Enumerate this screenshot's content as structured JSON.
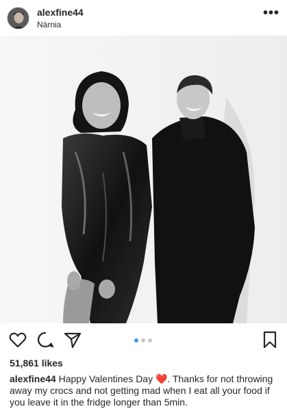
{
  "post": {
    "username": "alexfine44",
    "location": "Nárnia",
    "more_glyph": "•••"
  },
  "icons": {
    "avatar": "avatar",
    "more": "more-horizontal-icon",
    "like": "heart-outline-icon",
    "comment": "comment-bubble-icon",
    "share": "paper-plane-icon",
    "save": "bookmark-outline-icon"
  },
  "carousel": {
    "count": 3,
    "active_index": 0
  },
  "likes": {
    "label": "51,861 likes"
  },
  "caption": {
    "username": "alexfine44",
    "text_before_emoji": " Happy Valentines Day ",
    "emoji": "❤️",
    "text_after_emoji": ". Thanks for not throwing away my crocs and not getting mad when I eat all your food if you leave it in the fridge longer than 5min."
  },
  "colors": {
    "text": "#262626",
    "carousel_active": "#3897f0",
    "carousel_inactive": "#c7c7c7",
    "heart_emoji": "#e0245e"
  }
}
